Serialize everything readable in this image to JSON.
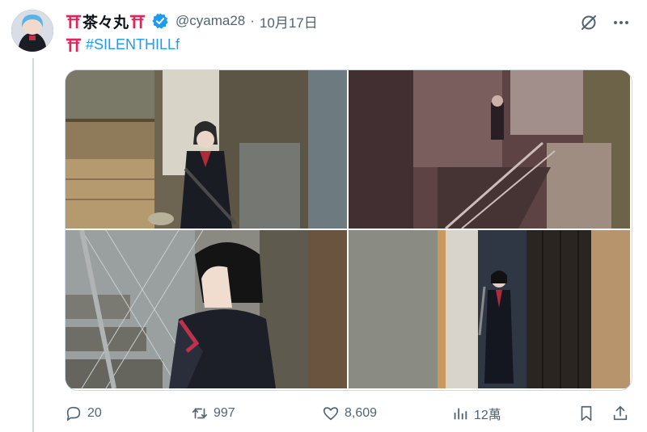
{
  "tweet": {
    "display_name": "茶々丸",
    "handle": "@cyama28",
    "separator": "·",
    "date": "10月17日",
    "hashtag": "#SILENTHILLf",
    "media": [
      {
        "alt": ""
      },
      {
        "alt": ""
      },
      {
        "alt": ""
      },
      {
        "alt": ""
      }
    ]
  },
  "actions": {
    "replies": "20",
    "reposts": "997",
    "likes": "8,609",
    "views": "12萬"
  },
  "colors": {
    "accent": "#1d9bf0",
    "secondary_text": "#536471",
    "torii": "#e0245e"
  }
}
